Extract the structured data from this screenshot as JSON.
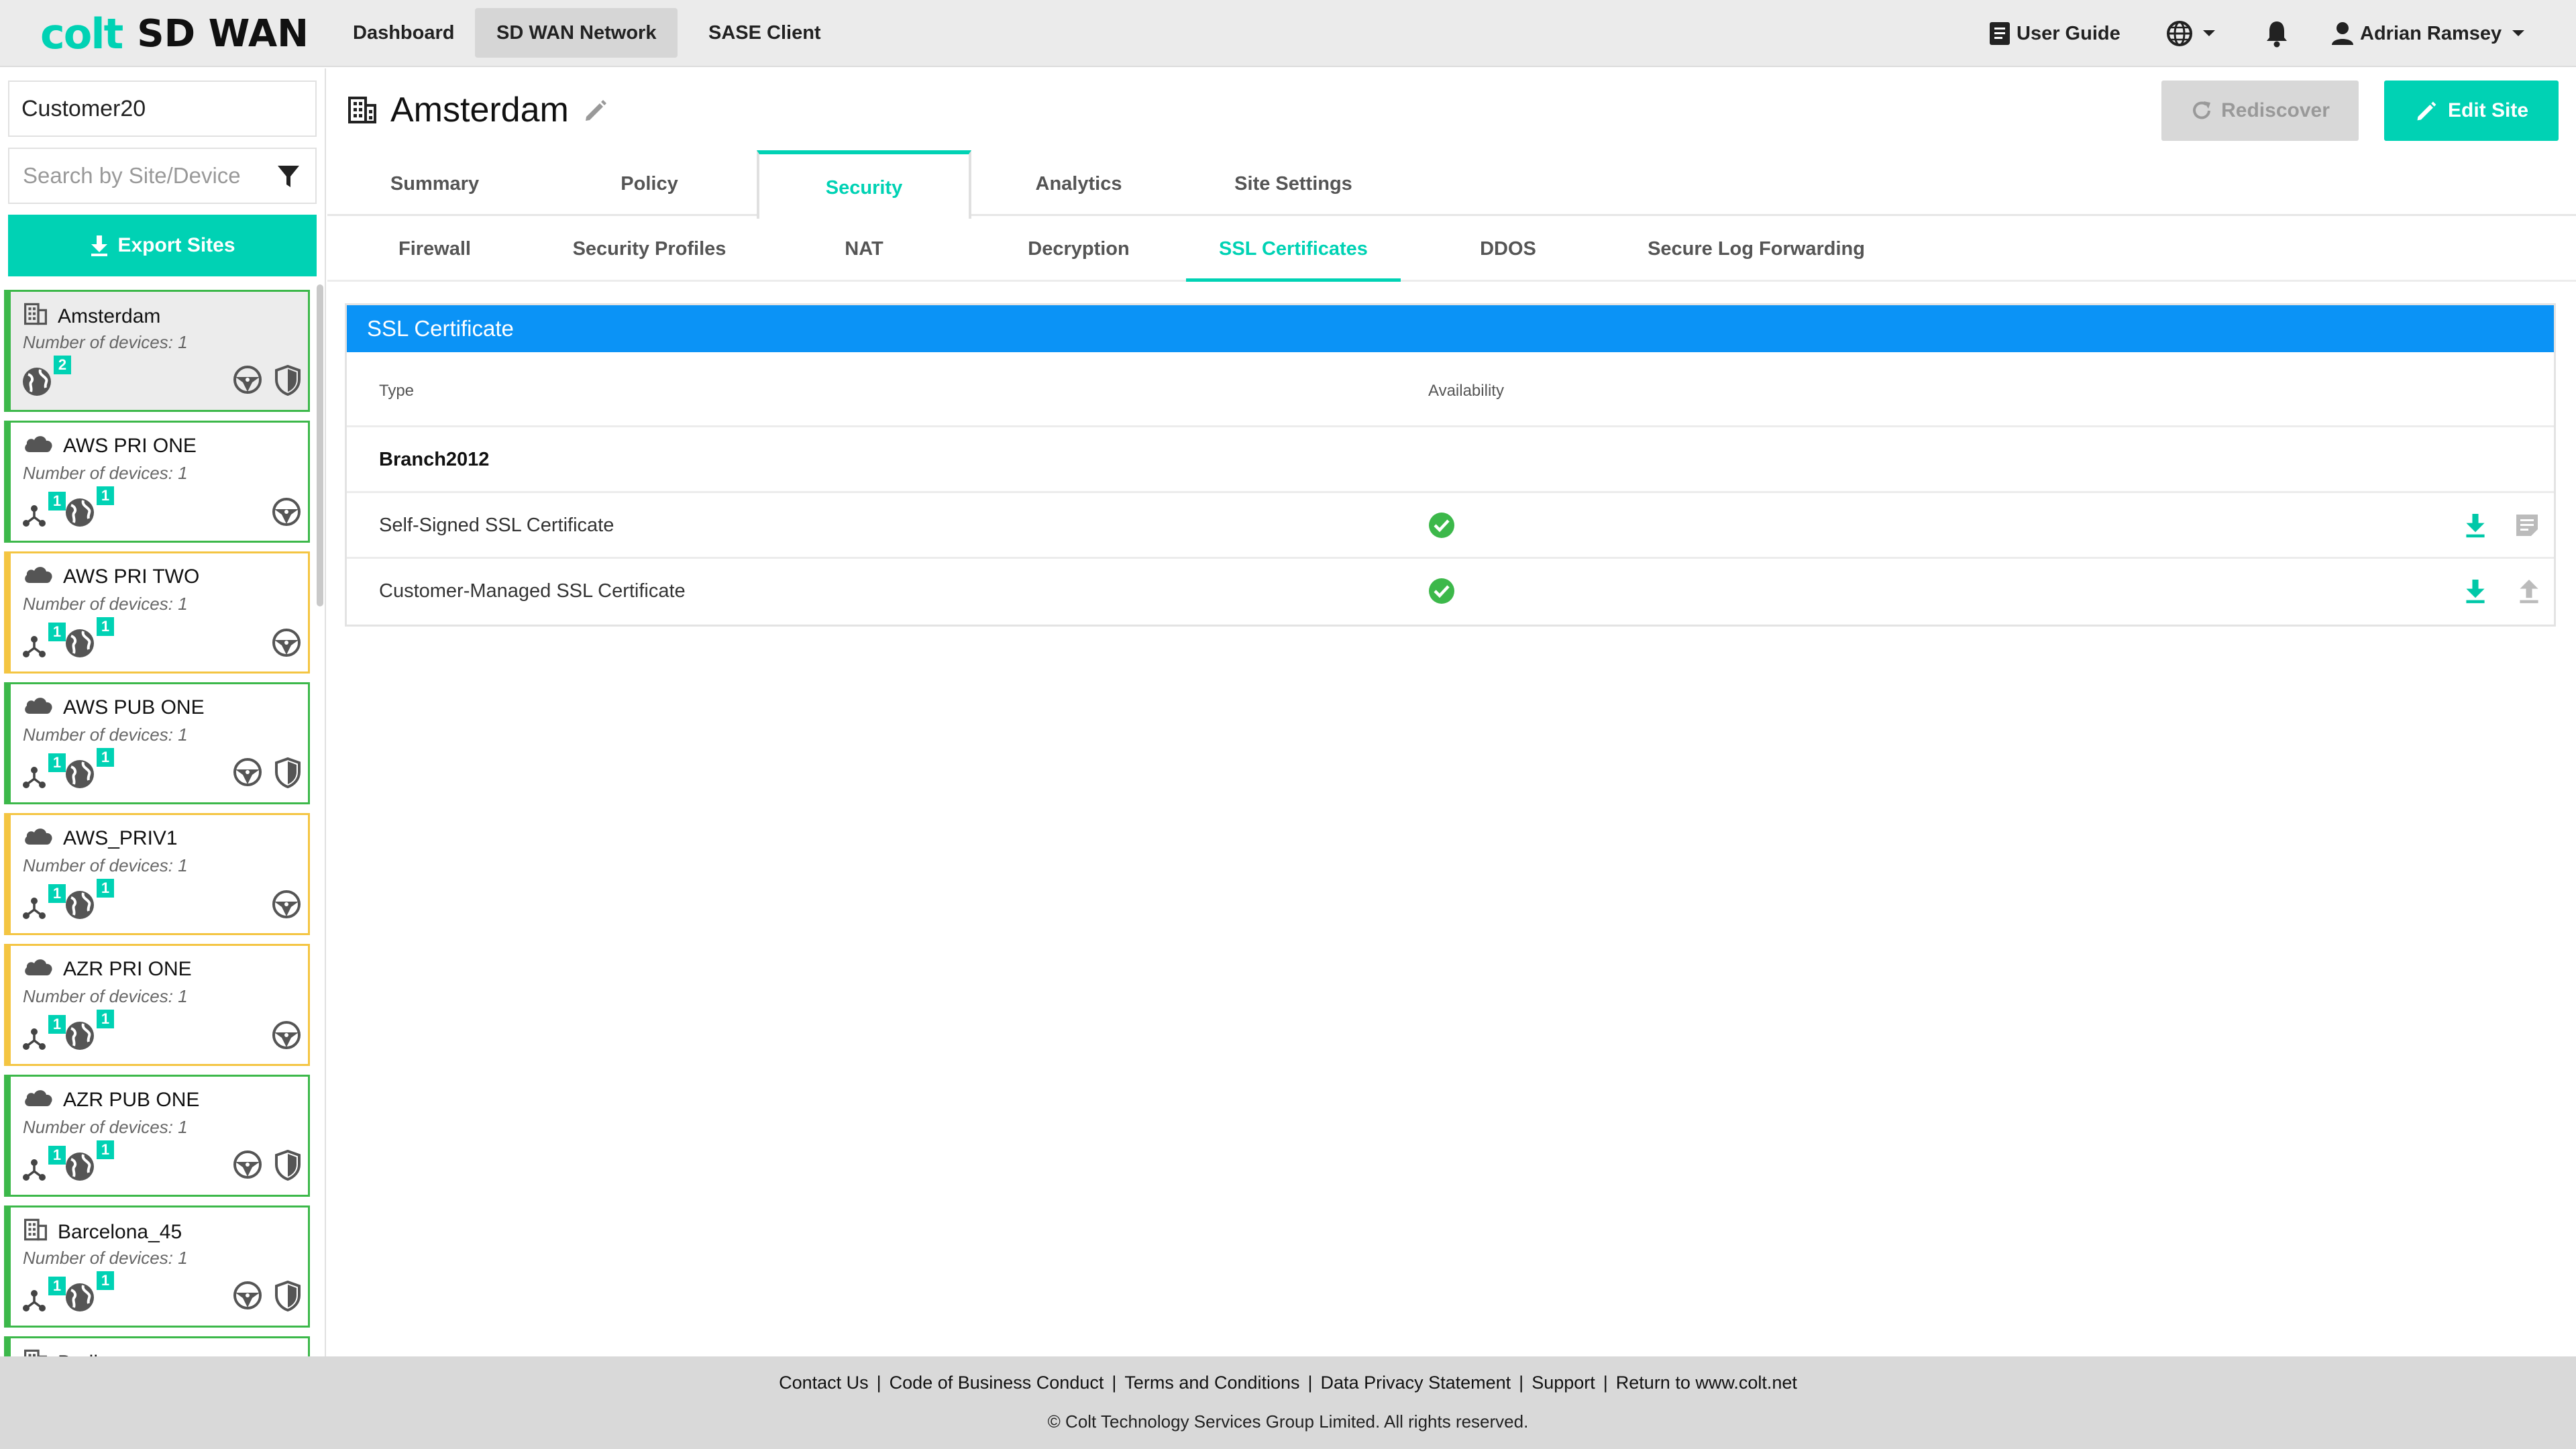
{
  "app": {
    "brand": "colt",
    "product": "SD WAN"
  },
  "nav": [
    {
      "label": "Dashboard",
      "active": false
    },
    {
      "label": "SD WAN Network",
      "active": true
    },
    {
      "label": "SASE Client",
      "active": false
    }
  ],
  "header_right": {
    "user_guide": "User Guide",
    "user": "Adrian Ramsey"
  },
  "sidebar": {
    "customer": "Customer20",
    "search_placeholder": "Search by Site/Device",
    "export_label": "Export Sites",
    "sites": [
      {
        "name": "Amsterdam",
        "devices": "Number of devices: 1",
        "type": "building",
        "status": "green",
        "selected": true,
        "badges": [
          "2"
        ],
        "nodes": false,
        "shield": true
      },
      {
        "name": "AWS PRI ONE",
        "devices": "Number of devices: 1",
        "type": "cloud",
        "status": "green",
        "selected": false,
        "badges": [
          "1",
          "1"
        ],
        "nodes": true,
        "shield": false
      },
      {
        "name": "AWS PRI TWO",
        "devices": "Number of devices: 1",
        "type": "cloud",
        "status": "amber",
        "selected": false,
        "badges": [
          "1",
          "1"
        ],
        "nodes": true,
        "shield": false
      },
      {
        "name": "AWS PUB ONE",
        "devices": "Number of devices: 1",
        "type": "cloud",
        "status": "green",
        "selected": false,
        "badges": [
          "1",
          "1"
        ],
        "nodes": true,
        "shield": true
      },
      {
        "name": "AWS_PRIV1",
        "devices": "Number of devices: 1",
        "type": "cloud",
        "status": "amber",
        "selected": false,
        "badges": [
          "1",
          "1"
        ],
        "nodes": true,
        "shield": false
      },
      {
        "name": "AZR PRI ONE",
        "devices": "Number of devices: 1",
        "type": "cloud",
        "status": "amber",
        "selected": false,
        "badges": [
          "1",
          "1"
        ],
        "nodes": true,
        "shield": false
      },
      {
        "name": "AZR PUB ONE",
        "devices": "Number of devices: 1",
        "type": "cloud",
        "status": "green",
        "selected": false,
        "badges": [
          "1",
          "1"
        ],
        "nodes": true,
        "shield": true
      },
      {
        "name": "Barcelona_45",
        "devices": "Number of devices: 1",
        "type": "building",
        "status": "green",
        "selected": false,
        "badges": [
          "1",
          "1"
        ],
        "nodes": true,
        "shield": true
      },
      {
        "name": "Berlin",
        "devices": "",
        "type": "building",
        "status": "green",
        "selected": false,
        "badges": [],
        "nodes": false,
        "shield": false
      }
    ]
  },
  "main": {
    "site_title": "Amsterdam",
    "rediscover_label": "Rediscover",
    "edit_label": "Edit Site",
    "tabs": [
      "Summary",
      "Policy",
      "Security",
      "Analytics",
      "Site Settings"
    ],
    "active_tab": "Security",
    "subtabs": [
      "Firewall",
      "Security Profiles",
      "NAT",
      "Decryption",
      "SSL Certificates",
      "DDOS",
      "Secure Log Forwarding"
    ],
    "active_subtab": "SSL Certificates",
    "panel": {
      "title": "SSL Certificate",
      "col_type": "Type",
      "col_availability": "Availability",
      "group": "Branch2012",
      "rows": [
        {
          "type": "Self-Signed SSL Certificate",
          "available": true,
          "actions": [
            "download-icon",
            "note-icon"
          ]
        },
        {
          "type": "Customer-Managed SSL Certificate",
          "available": true,
          "actions": [
            "download-icon",
            "upload-icon"
          ]
        }
      ]
    }
  },
  "footer": {
    "links": [
      "Contact Us",
      "Code of Business Conduct",
      "Terms and Conditions",
      "Data Privacy Statement",
      "Support",
      "Return to www.colt.net"
    ],
    "copyright": "© Colt Technology Services Group Limited. All rights reserved."
  },
  "colors": {
    "accent": "#00d2b4",
    "header_blue": "#0b93f6",
    "ok_green": "#3cb84a",
    "warn_amber": "#f4c542"
  }
}
